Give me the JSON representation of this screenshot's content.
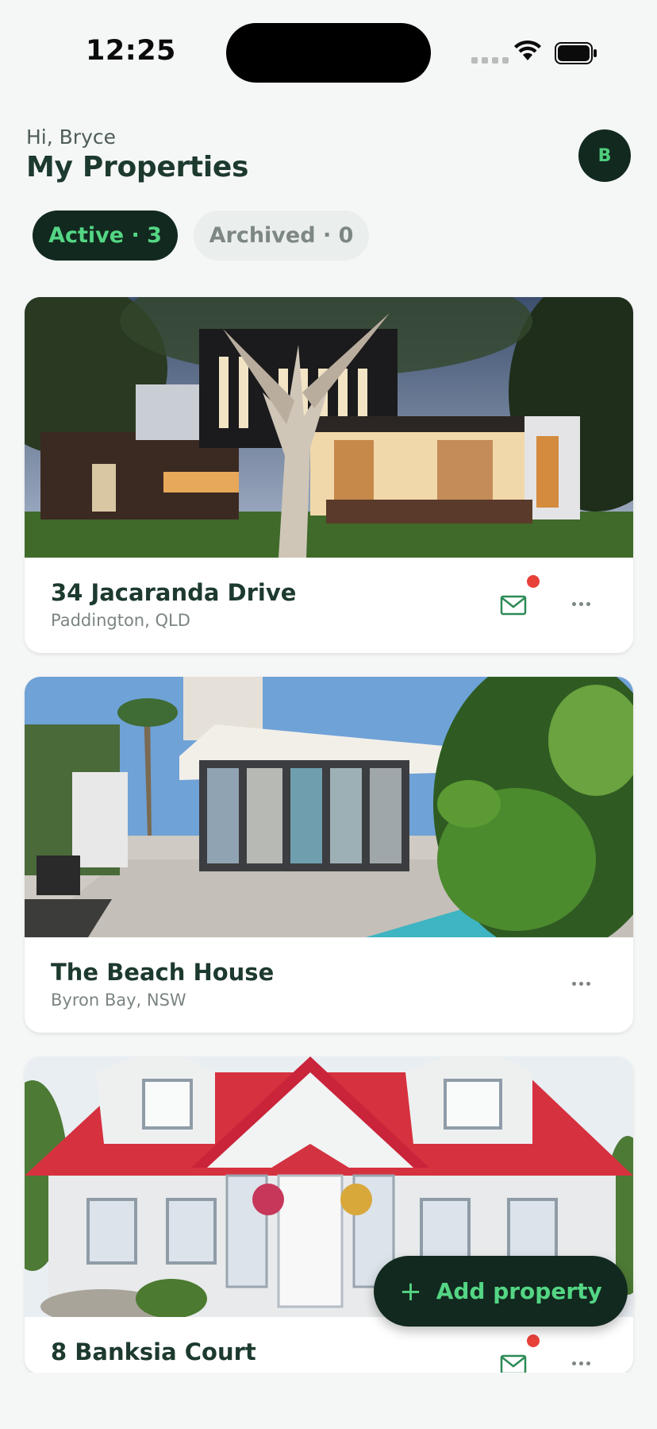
{
  "status_bar": {
    "time": "12:25"
  },
  "header": {
    "greeting": "Hi, Bryce",
    "title": "My Properties",
    "avatar_initial": "B"
  },
  "tabs": [
    {
      "label": "Active · 3",
      "selected": true
    },
    {
      "label": "Archived · 0",
      "selected": false
    }
  ],
  "properties": [
    {
      "name": "34 Jacaranda Drive",
      "location": "Paddington, QLD",
      "has_messages": true,
      "unread": true
    },
    {
      "name": "The Beach House",
      "location": "Byron Bay, NSW",
      "has_messages": false,
      "unread": false
    },
    {
      "name": "8 Banksia Court",
      "location": "",
      "has_messages": true,
      "unread": true
    }
  ],
  "fab": {
    "label": "Add property",
    "icon": "plus-icon"
  },
  "colors": {
    "accent": "#54d684",
    "dark": "#12291f",
    "badge": "#e8413a",
    "background": "#f5f7f6"
  }
}
